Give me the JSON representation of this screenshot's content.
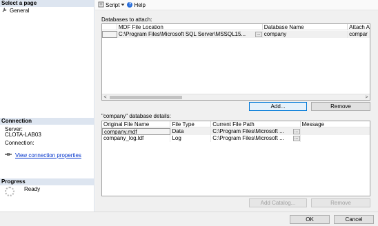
{
  "left": {
    "select_page_header": "Select a page",
    "pages": [
      {
        "label": "General",
        "icon": "wrench-icon"
      }
    ],
    "connection_header": "Connection",
    "server_label": "Server:",
    "server_value": "CLOTA-LAB03",
    "connection_label": "Connection:",
    "view_connection_link": "View connection properties",
    "progress_header": "Progress",
    "progress_status": "Ready"
  },
  "toolbar": {
    "script_label": "Script",
    "help_label": "Help"
  },
  "attach": {
    "label": "Databases to attach:",
    "columns": [
      "MDF File Location",
      "Database Name",
      "Attach A"
    ],
    "rows": [
      {
        "mdf": "C:\\Program Files\\Microsoft SQL Server\\MSSQL15...",
        "database": "company",
        "attach_as": "compar"
      }
    ],
    "add_button": "Add...",
    "remove_button": "Remove"
  },
  "details": {
    "label": "\"company\" database details:",
    "columns": [
      "Original File Name",
      "File Type",
      "Current File Path",
      "Message"
    ],
    "rows": [
      {
        "name": "company.mdf",
        "type": "Data",
        "path": "C:\\Program Files\\Microsoft ...",
        "message": ""
      },
      {
        "name": "company_log.ldf",
        "type": "Log",
        "path": "C:\\Program Files\\Microsoft ...",
        "message": ""
      }
    ],
    "add_catalog_button": "Add Catalog...",
    "remove_button": "Remove"
  },
  "footer": {
    "ok_button": "OK",
    "cancel_button": "Cancel"
  }
}
